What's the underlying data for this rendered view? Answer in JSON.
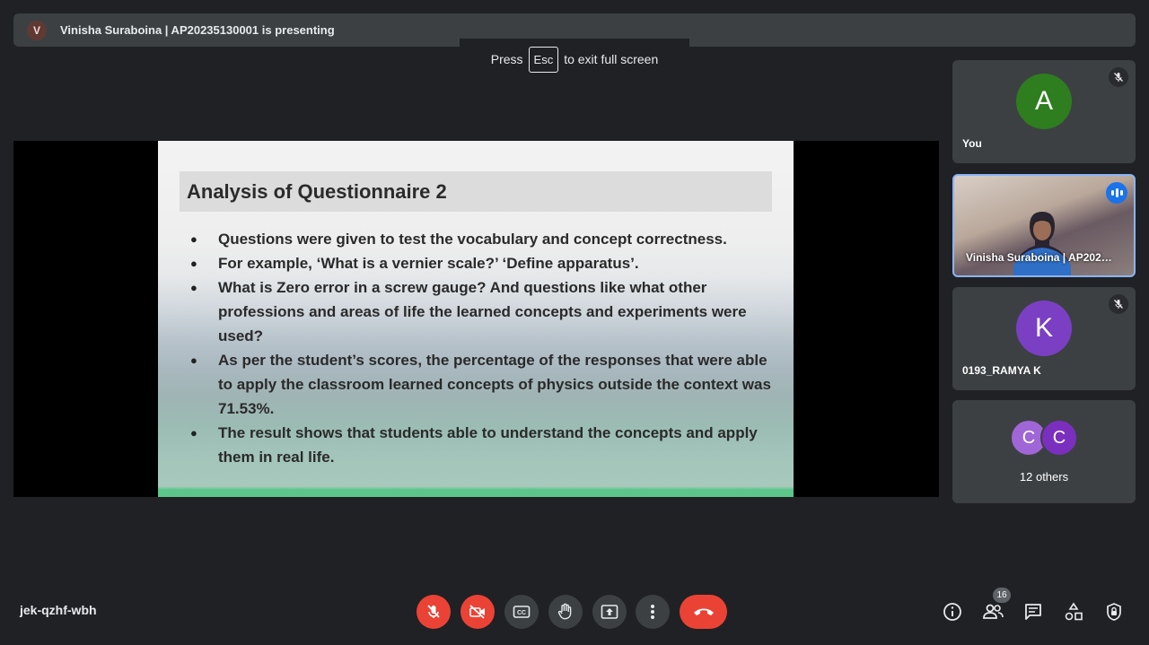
{
  "presenter": {
    "avatar_letter": "V",
    "text": "Vinisha Suraboina | AP20235130001 is presenting"
  },
  "toast": {
    "press": "Press",
    "key": "Esc",
    "suffix": "to exit full screen"
  },
  "slide": {
    "title": "Analysis of Questionnaire 2",
    "bullets": [
      "Questions were given to test the vocabulary and concept correctness.",
      "For example, ‘What is a vernier scale?’ ‘Define apparatus’.",
      "What is Zero error in a screw gauge? And questions like what other professions and areas of life the learned concepts and experiments were used?",
      "As per the student’s scores, the percentage of the responses that were able to apply the classroom learned concepts of physics outside the context was 71.53%.",
      "The result shows that students able to understand the concepts and apply them in real life."
    ]
  },
  "participants": [
    {
      "letter": "A",
      "name": "You",
      "color": "#1e8e3e",
      "muted": true
    },
    {
      "name": "Vinisha Suraboina | AP202…",
      "speaking": true
    },
    {
      "letter": "K",
      "name": "0193_RAMYA K",
      "color": "#8430ce",
      "muted": true
    },
    {
      "letters": [
        "C",
        "C"
      ],
      "name": "12 others"
    }
  ],
  "meeting_code": "jek-qzhf-wbh",
  "people_count": "16",
  "icons": {
    "mic": "mic-off-icon",
    "camera": "camera-off-icon",
    "captions": "captions-icon",
    "hand": "raise-hand-icon",
    "present": "present-icon",
    "more": "more-vert-icon",
    "hangup": "hangup-icon",
    "info": "info-icon",
    "people": "people-icon",
    "chat": "chat-icon",
    "activities": "activities-icon",
    "host": "host-controls-icon"
  },
  "colors": {
    "accent": "#8ab4f8",
    "danger": "#ea4335",
    "surface": "#3c4043",
    "background": "#202124"
  }
}
